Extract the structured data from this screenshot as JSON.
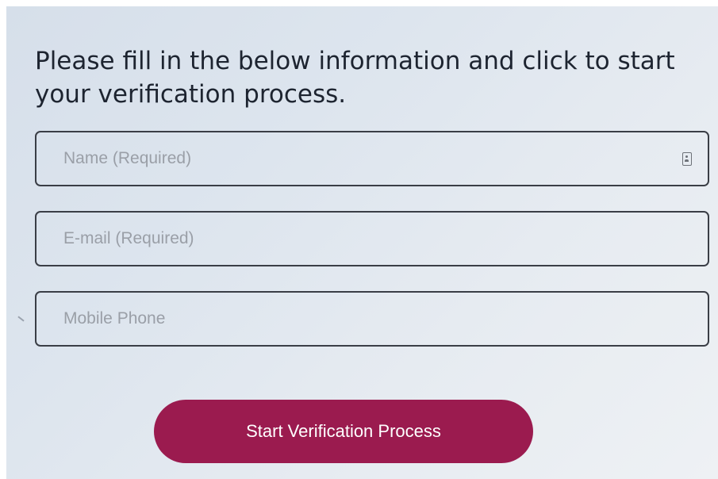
{
  "form": {
    "intro_text": "Please fill in the below information and click to start your verification process.",
    "name_field": {
      "placeholder": "Name (Required)",
      "value": "",
      "icon": "contact-card-icon"
    },
    "email_field": {
      "placeholder": "E-mail (Required)",
      "value": ""
    },
    "phone_field": {
      "placeholder": "Mobile Phone",
      "value": ""
    },
    "submit_label": "Start Verification Process"
  },
  "colors": {
    "accent": "#9b1b4f",
    "field_border": "#3a3e46",
    "text": "#1d2430",
    "placeholder": "#9a9fa7"
  }
}
